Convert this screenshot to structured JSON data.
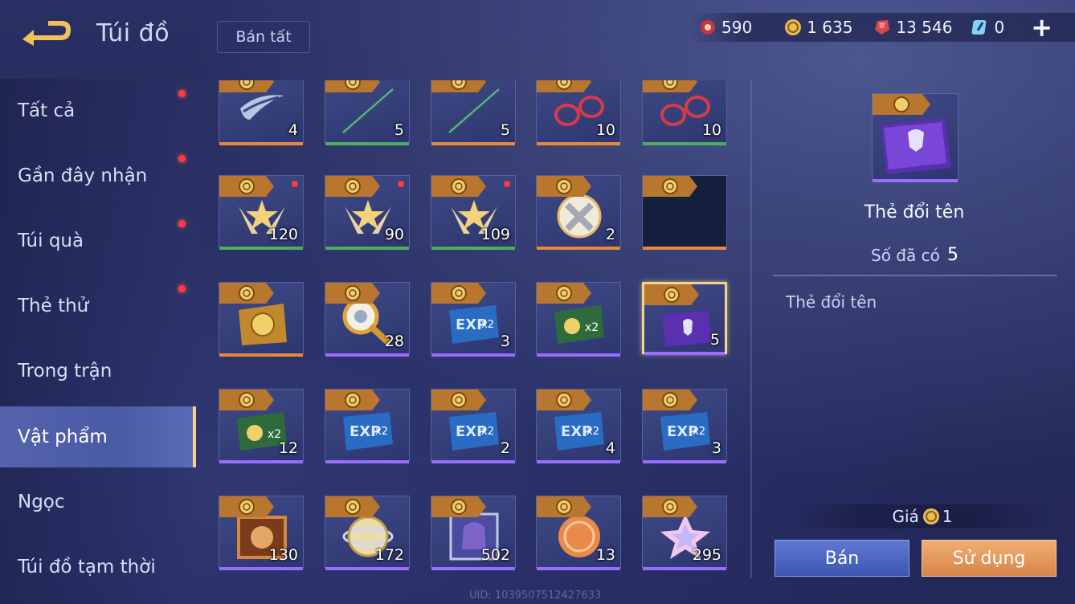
{
  "header": {
    "title": "Túi đồ",
    "sell_all_label": "Bán tất"
  },
  "currencies": [
    {
      "icon": "red-voucher-icon",
      "value": "590",
      "color": "#e0463f"
    },
    {
      "icon": "gold-coin-icon",
      "value": "1 635",
      "color": "#e9c25a"
    },
    {
      "icon": "red-gem-icon",
      "value": "13 546",
      "color": "#e2545b"
    },
    {
      "icon": "blue-crystal-icon",
      "value": "0",
      "color": "#79c8f2"
    }
  ],
  "add_label": "+",
  "sidebar": {
    "items": [
      {
        "label": "Tất cả",
        "badge": true
      },
      {
        "label": "Gần đây nhận",
        "badge": true
      },
      {
        "label": "Túi quà",
        "badge": true
      },
      {
        "label": "Thẻ thử",
        "badge": true
      },
      {
        "label": "Trong trận",
        "badge": false
      },
      {
        "label": "Vật phẩm",
        "badge": false,
        "active": true
      },
      {
        "label": "Ngọc",
        "badge": false
      },
      {
        "label": "Túi đồ tạm thời",
        "badge": false
      }
    ]
  },
  "grid": {
    "items": [
      {
        "count": "4",
        "art": "blade-icon",
        "rarity": "orange"
      },
      {
        "count": "5",
        "art": "staff-icon",
        "rarity": "green"
      },
      {
        "count": "5",
        "art": "staff-icon",
        "rarity": "orange"
      },
      {
        "count": "10",
        "art": "glasses-icon",
        "rarity": "orange"
      },
      {
        "count": "10",
        "art": "glasses-icon",
        "rarity": "green"
      },
      {
        "count": "120",
        "art": "star-wings-icon",
        "rarity": "green",
        "badge": true
      },
      {
        "count": "90",
        "art": "star-wings-icon",
        "rarity": "green",
        "badge": true
      },
      {
        "count": "109",
        "art": "star-wings-icon",
        "rarity": "green",
        "badge": true
      },
      {
        "count": "2",
        "art": "crystal-orb-icon",
        "rarity": "orange"
      },
      {
        "count": "",
        "art": "empty-slot",
        "rarity": "orange"
      },
      {
        "count": "",
        "art": "gold-card-icon",
        "rarity": "orange"
      },
      {
        "count": "28",
        "art": "golden-scepter-icon",
        "rarity": "purple"
      },
      {
        "count": "3",
        "art": "exp-card-icon",
        "rarity": "purple"
      },
      {
        "count": "",
        "art": "gold-x2-card-icon",
        "rarity": "purple"
      },
      {
        "count": "5",
        "art": "rename-card-icon",
        "rarity": "purple",
        "selected": true
      },
      {
        "count": "12",
        "art": "gold-x2-card-icon",
        "rarity": "purple"
      },
      {
        "count": "",
        "art": "exp-card-icon",
        "rarity": "purple"
      },
      {
        "count": "2",
        "art": "exp-card-icon",
        "rarity": "purple"
      },
      {
        "count": "4",
        "art": "exp-card-icon",
        "rarity": "purple"
      },
      {
        "count": "3",
        "art": "exp-card-icon",
        "rarity": "purple"
      },
      {
        "count": "130",
        "art": "chest-icon",
        "rarity": "purple"
      },
      {
        "count": "172",
        "art": "globe-icon",
        "rarity": "purple"
      },
      {
        "count": "502",
        "art": "helmet-icon",
        "rarity": "purple"
      },
      {
        "count": "13",
        "art": "dragon-token-icon",
        "rarity": "purple"
      },
      {
        "count": "295",
        "art": "pink-star-gem-icon",
        "rarity": "purple"
      }
    ]
  },
  "detail": {
    "name": "Thẻ đổi tên",
    "owned_label": "Số đã có",
    "owned_value": "5",
    "description": "Thẻ đổi tên",
    "price_label": "Giá",
    "price_value": "1",
    "sell_label": "Bán",
    "use_label": "Sử dụng"
  },
  "uid": "UID: 1039507512427633",
  "colors": {
    "orange": "#e8883a",
    "green": "#4caf5e",
    "purple": "#9a6cff",
    "accent_gold": "#f0d08a"
  }
}
